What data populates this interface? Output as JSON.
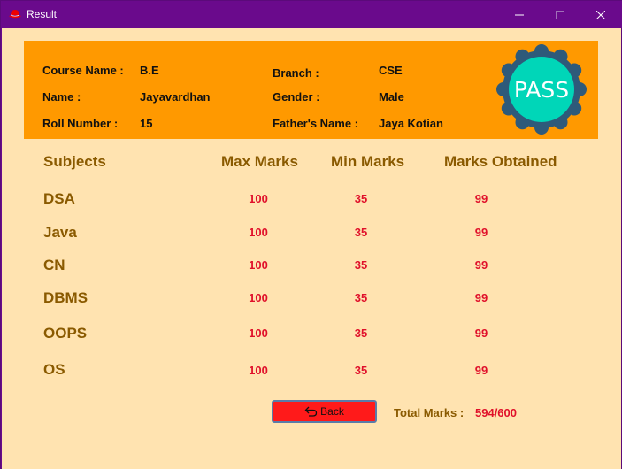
{
  "window": {
    "title": "Result"
  },
  "student": {
    "course_label": "Course Name :",
    "course_value": "B.E",
    "name_label": "Name :",
    "name_value": "Jayavardhan",
    "roll_label": "Roll Number  :",
    "roll_value": "15",
    "branch_label": "Branch :",
    "branch_value": "CSE",
    "gender_label": "Gender :",
    "gender_value": "Male",
    "father_label": "Father's Name :",
    "father_value": "Jaya Kotian"
  },
  "badge": {
    "text": "PASS",
    "ring_color": "#2e5a7a",
    "fill_color": "#00d6b8"
  },
  "table": {
    "headers": [
      "Subjects",
      "Max Marks",
      "Min Marks",
      "Marks Obtained"
    ],
    "rows": [
      {
        "subject": "DSA",
        "max": "100",
        "min": "35",
        "obtained": "99"
      },
      {
        "subject": "Java",
        "max": "100",
        "min": "35",
        "obtained": "99"
      },
      {
        "subject": "CN",
        "max": "100",
        "min": "35",
        "obtained": "99"
      },
      {
        "subject": "DBMS",
        "max": "100",
        "min": "35",
        "obtained": "99"
      },
      {
        "subject": "OOPS",
        "max": "100",
        "min": "35",
        "obtained": "99"
      },
      {
        "subject": "OS",
        "max": "100",
        "min": "35",
        "obtained": "99"
      }
    ]
  },
  "footer": {
    "back_label": "Back",
    "total_label": "Total Marks :",
    "total_value": "594/600"
  },
  "colors": {
    "titlebar": "#6a0a8c",
    "background": "#ffe3b0",
    "header_panel": "#ff9900",
    "heading_text": "#8a5a00",
    "marks_text": "#e0102a",
    "back_button": "#ff1a1a"
  },
  "icons": {
    "app": "redhat-logo-icon",
    "minimize": "minimize-icon",
    "maximize": "maximize-icon",
    "close": "close-icon",
    "back": "undo-arrow-icon"
  }
}
